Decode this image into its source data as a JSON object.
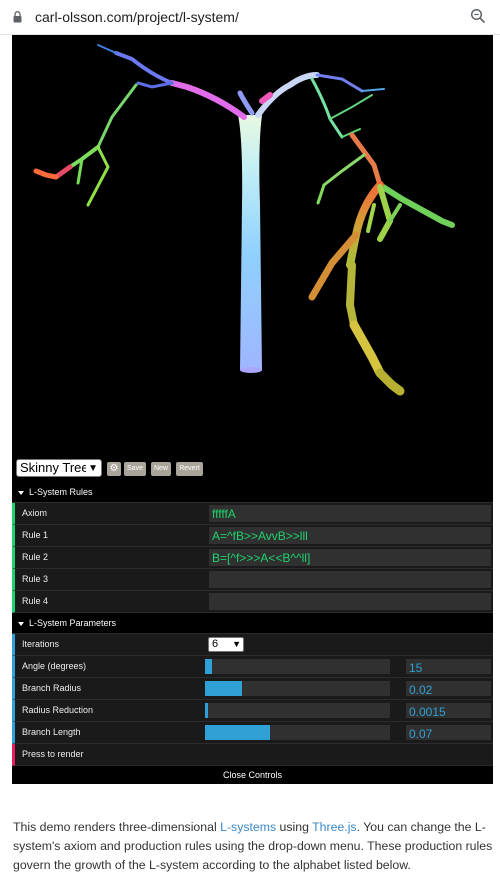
{
  "browser": {
    "url": "carl-olsson.com/project/l-system/"
  },
  "toolbar": {
    "preset": "Skinny Tree",
    "save_label": "Save",
    "new_label": "New",
    "revert_label": "Revert"
  },
  "gui": {
    "rules_folder": "L-System Rules",
    "rules": [
      {
        "label": "Axiom",
        "value": "fffffA"
      },
      {
        "label": "Rule 1",
        "value": "A=^fB>>AvvB>>lll"
      },
      {
        "label": "Rule 2",
        "value": "B=[^f>>>A<<B^^ll]"
      },
      {
        "label": "Rule 3",
        "value": ""
      },
      {
        "label": "Rule 4",
        "value": ""
      }
    ],
    "params_folder": "L-System Parameters",
    "iterations_label": "Iterations",
    "iterations_value": "6",
    "params": [
      {
        "label": "Angle (degrees)",
        "value": "15",
        "fill_fraction": 0.04
      },
      {
        "label": "Branch Radius",
        "value": "0.02",
        "fill_fraction": 0.2
      },
      {
        "label": "Radius Reduction",
        "value": "0.0015",
        "fill_fraction": 0.015
      },
      {
        "label": "Branch Length",
        "value": "0.07",
        "fill_fraction": 0.35
      }
    ],
    "render_label": "Press to render",
    "close_label": "Close Controls"
  },
  "description": {
    "t1": "This demo renders three-dimensional ",
    "link1": "L-systems",
    "t2": " using ",
    "link2": "Three.js",
    "t3": ". You can change the L-system's axiom and production rules  using the drop-down menu. These production rules govern the growth of the L-system according to the alphabet listed below."
  },
  "colors": {
    "text_controller": "#1ed36f",
    "number_controller": "#2fa1d6",
    "function_controller": "#e61d5f",
    "link": "#3a87c5"
  },
  "icons": [
    "lock-icon",
    "zoom-icon",
    "gear-icon",
    "folder-toggle-icon",
    "chevron-down-icon"
  ]
}
